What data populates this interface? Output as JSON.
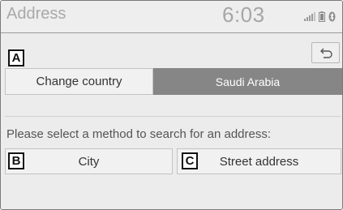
{
  "header": {
    "title": "Address",
    "time": "6:03",
    "icons": [
      "signal-icon",
      "battery-icon",
      "bluetooth-icon"
    ]
  },
  "markers": {
    "a": "A",
    "b": "B",
    "c": "C"
  },
  "country_row": {
    "change_label": "Change country",
    "selected_country": "Saudi Arabia"
  },
  "prompt": "Please select a method to search for an address:",
  "methods": {
    "city_label": "City",
    "street_label": "Street address"
  },
  "colors": {
    "selected_bg": "#868686",
    "button_bg": "#f1f1f1",
    "screen_bg": "#ececec"
  }
}
